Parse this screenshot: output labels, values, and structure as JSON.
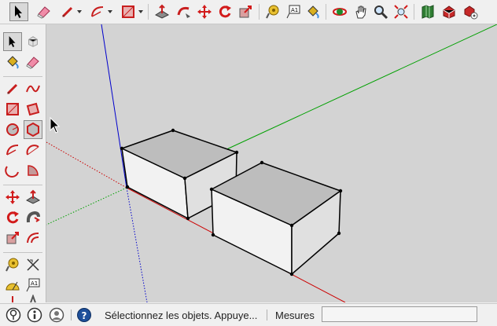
{
  "toolbar": {
    "icons": [
      "select-icon",
      "eraser-icon",
      "pencil-icon",
      "arc-icon",
      "rectangle-icon",
      "push-pull-icon",
      "follow-me-icon",
      "move-icon",
      "rotate-icon",
      "scale-icon",
      "tape-measure-icon",
      "text-icon",
      "paint-bucket-icon",
      "orbit-icon",
      "pan-icon",
      "zoom-icon",
      "zoom-extents-icon",
      "warehouse-icon",
      "extension-warehouse-icon",
      "extension-manager-icon"
    ]
  },
  "left_tools": {
    "icons": [
      "select-icon",
      "component-icon",
      "paint-bucket-icon",
      "eraser-icon",
      "line-icon",
      "freehand-icon",
      "rectangle-icon",
      "rotated-rectangle-icon",
      "circle-icon",
      "polygon-icon",
      "arc-icon",
      "two-point-arc-icon",
      "three-point-arc-icon",
      "pie-icon",
      "move-icon",
      "push-pull-icon",
      "rotate-icon",
      "follow-me-icon",
      "scale-icon",
      "offset-icon",
      "tape-measure-icon",
      "dimension-icon",
      "protractor-icon",
      "text-icon",
      "axes-icon",
      "3d-text-icon"
    ]
  },
  "status": {
    "message": "Sélectionnez les objets. Appuye...",
    "measures_label": "Mesures",
    "measures_value": ""
  },
  "colors": {
    "viewport_bg": "#d3d3d3",
    "axis_red": "#cc0000",
    "axis_green": "#00a000",
    "axis_blue": "#0000cc",
    "box_top": "#bdbdbd",
    "box_front": "#f2f2f2",
    "box_side": "#e2e2e2"
  }
}
